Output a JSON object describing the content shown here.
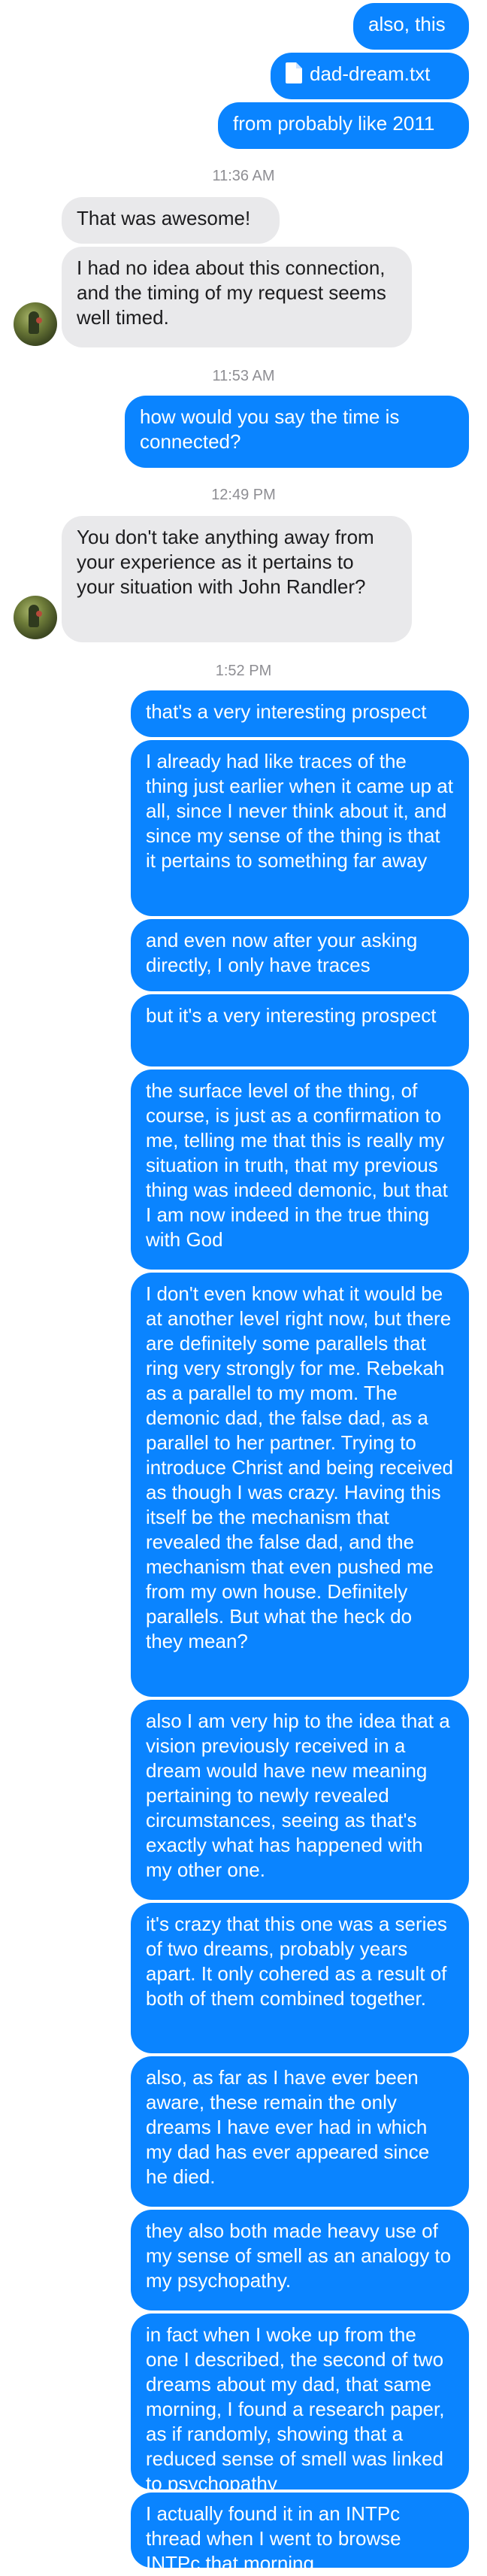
{
  "messages": {
    "m1": "also, this",
    "m2_file": "dad-dream.txt",
    "m3": "from probably like 2011",
    "t1": "11:36 AM",
    "m4": "That was awesome!",
    "m5": "I had no idea about this connection, and the timing of my request seems well timed.",
    "t2": "11:53 AM",
    "m6": "how would you say the time is connected?",
    "t3": "12:49 PM",
    "m7": "You don't take anything away from your experience as it pertains to your situation with John Randler?",
    "t4": "1:52 PM",
    "m8": "that's a very interesting prospect",
    "m9": "I already had like traces of the thing just earlier when it came up at all, since I never think about it, and since my sense of the thing is that it pertains to something far away",
    "m10": "and even now after your asking directly, I only have traces",
    "m11": "but it's a very interesting prospect",
    "m12": "the surface level of the thing, of course, is just as a confirmation to me, telling me that this is really my situation in truth, that my previous thing was indeed demonic, but that I am now indeed in the true thing with God",
    "m13": "I don't even know what it would be at another level right now, but there are definitely some parallels that ring very strongly for me. Rebekah as a parallel to my mom. The demonic dad, the false dad, as a parallel to her partner. Trying to introduce Christ and being received as though I was crazy. Having this itself be the mechanism that revealed the false dad, and the mechanism that even pushed me from my own house. Definitely parallels. But what the heck do they mean?",
    "m14": "also I am very hip to the idea that a vision previously received in a dream would have new meaning pertaining to newly revealed circumstances, seeing as that's exactly what has happened with my other one.",
    "m15": "it's crazy that this one was a series of two dreams, probably years apart. It only cohered as a result of both of them combined together.",
    "m16": "also, as far as I have ever been aware, these remain the only dreams I have ever had in which my dad has ever appeared since he died.",
    "m17": "they also both made heavy use of my sense of smell as an analogy to my psychopathy.",
    "m18": "in fact when I woke up from the one I described, the second of two dreams about my dad, that same morning, I found a research paper, as if randomly, showing that a reduced sense of smell was linked to psychopathy",
    "m19": "I actually found it in an INTPc thread when I went to browse INTPc that morning"
  },
  "colors": {
    "outgoing": "#0a84ff",
    "incoming": "#e9e9eb",
    "timestamp": "#8e8e93"
  },
  "icons": {
    "file": "document-icon",
    "avatar": "contact-avatar"
  }
}
